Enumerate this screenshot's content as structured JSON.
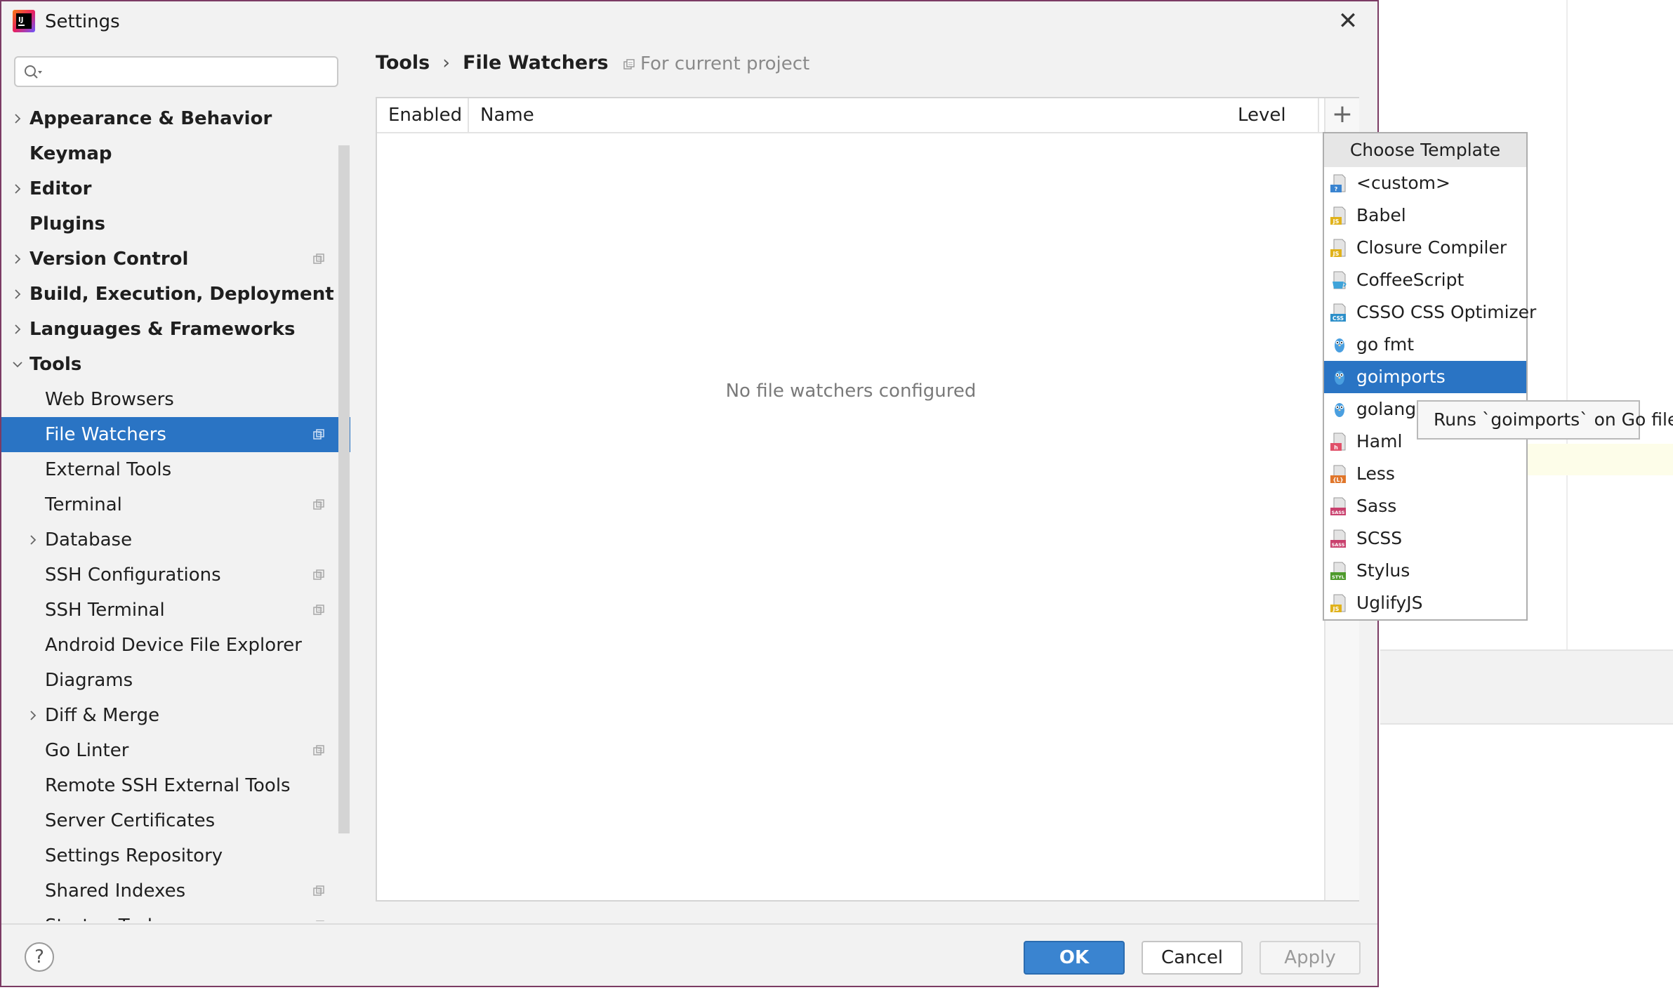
{
  "window": {
    "title": "Settings"
  },
  "sidebar": {
    "search_placeholder": "",
    "items": [
      {
        "label": "Appearance & Behavior",
        "level": 0,
        "bold": true,
        "expandable": true,
        "expanded": false,
        "project": false
      },
      {
        "label": "Keymap",
        "level": 0,
        "bold": true,
        "expandable": false,
        "expanded": false,
        "project": false
      },
      {
        "label": "Editor",
        "level": 0,
        "bold": true,
        "expandable": true,
        "expanded": false,
        "project": false
      },
      {
        "label": "Plugins",
        "level": 0,
        "bold": true,
        "expandable": false,
        "expanded": false,
        "project": false
      },
      {
        "label": "Version Control",
        "level": 0,
        "bold": true,
        "expandable": true,
        "expanded": false,
        "project": true
      },
      {
        "label": "Build, Execution, Deployment",
        "level": 0,
        "bold": true,
        "expandable": true,
        "expanded": false,
        "project": false
      },
      {
        "label": "Languages & Frameworks",
        "level": 0,
        "bold": true,
        "expandable": true,
        "expanded": false,
        "project": false
      },
      {
        "label": "Tools",
        "level": 0,
        "bold": true,
        "expandable": true,
        "expanded": true,
        "project": false
      },
      {
        "label": "Web Browsers",
        "level": 1,
        "bold": false,
        "expandable": false,
        "expanded": false,
        "project": false
      },
      {
        "label": "File Watchers",
        "level": 1,
        "bold": false,
        "expandable": false,
        "expanded": false,
        "project": true,
        "selected": true
      },
      {
        "label": "External Tools",
        "level": 1,
        "bold": false,
        "expandable": false,
        "expanded": false,
        "project": false
      },
      {
        "label": "Terminal",
        "level": 1,
        "bold": false,
        "expandable": false,
        "expanded": false,
        "project": true
      },
      {
        "label": "Database",
        "level": 1,
        "bold": false,
        "expandable": true,
        "expanded": false,
        "project": false
      },
      {
        "label": "SSH Configurations",
        "level": 1,
        "bold": false,
        "expandable": false,
        "expanded": false,
        "project": true
      },
      {
        "label": "SSH Terminal",
        "level": 1,
        "bold": false,
        "expandable": false,
        "expanded": false,
        "project": true
      },
      {
        "label": "Android Device File Explorer",
        "level": 1,
        "bold": false,
        "expandable": false,
        "expanded": false,
        "project": false
      },
      {
        "label": "Diagrams",
        "level": 1,
        "bold": false,
        "expandable": false,
        "expanded": false,
        "project": false
      },
      {
        "label": "Diff & Merge",
        "level": 1,
        "bold": false,
        "expandable": true,
        "expanded": false,
        "project": false
      },
      {
        "label": "Go Linter",
        "level": 1,
        "bold": false,
        "expandable": false,
        "expanded": false,
        "project": true
      },
      {
        "label": "Remote SSH External Tools",
        "level": 1,
        "bold": false,
        "expandable": false,
        "expanded": false,
        "project": false
      },
      {
        "label": "Server Certificates",
        "level": 1,
        "bold": false,
        "expandable": false,
        "expanded": false,
        "project": false
      },
      {
        "label": "Settings Repository",
        "level": 1,
        "bold": false,
        "expandable": false,
        "expanded": false,
        "project": false
      },
      {
        "label": "Shared Indexes",
        "level": 1,
        "bold": false,
        "expandable": false,
        "expanded": false,
        "project": true
      },
      {
        "label": "Startup Tasks",
        "level": 1,
        "bold": false,
        "expandable": false,
        "expanded": false,
        "project": true
      }
    ]
  },
  "breadcrumb": {
    "parent": "Tools",
    "separator": "›",
    "current": "File Watchers",
    "scope": "For current project"
  },
  "table": {
    "columns": [
      "Enabled",
      "Name",
      "Level"
    ],
    "empty_text": "No file watchers configured",
    "add_icon": "+"
  },
  "popup": {
    "title": "Choose Template",
    "items": [
      {
        "label": "<custom>",
        "icon": "custom-file-icon",
        "badge": "?",
        "badge_color": "#3a84d0"
      },
      {
        "label": "Babel",
        "icon": "js-file-icon",
        "badge": "JS",
        "badge_color": "#e0b21b"
      },
      {
        "label": "Closure Compiler",
        "icon": "js-file-icon",
        "badge": "JS",
        "badge_color": "#e0b21b"
      },
      {
        "label": "CoffeeScript",
        "icon": "coffeescript-icon",
        "badge": "",
        "badge_color": "#3fa3d9"
      },
      {
        "label": "CSSO CSS Optimizer",
        "icon": "css-file-icon",
        "badge": "CSS",
        "badge_color": "#2c8fc9"
      },
      {
        "label": "go fmt",
        "icon": "gopher-icon",
        "badge": "",
        "badge_color": "#4a9fe0"
      },
      {
        "label": "goimports",
        "icon": "gopher-icon",
        "badge": "",
        "badge_color": "#4a9fe0",
        "selected": true
      },
      {
        "label": "golangci",
        "icon": "gopher-icon",
        "badge": "",
        "badge_color": "#4a9fe0"
      },
      {
        "label": "Haml",
        "icon": "haml-file-icon",
        "badge": "h",
        "badge_color": "#e0516a"
      },
      {
        "label": "Less",
        "icon": "less-file-icon",
        "badge": "{L}",
        "badge_color": "#e0762b"
      },
      {
        "label": "Sass",
        "icon": "sass-file-icon",
        "badge": "SASS",
        "badge_color": "#c9416e"
      },
      {
        "label": "SCSS",
        "icon": "scss-file-icon",
        "badge": "SASS",
        "badge_color": "#c9416e"
      },
      {
        "label": "Stylus",
        "icon": "stylus-file-icon",
        "badge": "STYL",
        "badge_color": "#4e9a2c"
      },
      {
        "label": "UglifyJS",
        "icon": "js-file-icon",
        "badge": "JS",
        "badge_color": "#e0b21b"
      }
    ]
  },
  "tooltip": {
    "text": "Runs `goimports` on Go file"
  },
  "buttons": {
    "ok": "OK",
    "cancel": "Cancel",
    "apply": "Apply",
    "help": "?"
  },
  "colors": {
    "accent": "#2a74c4",
    "dialog_border": "#7b3b64"
  }
}
